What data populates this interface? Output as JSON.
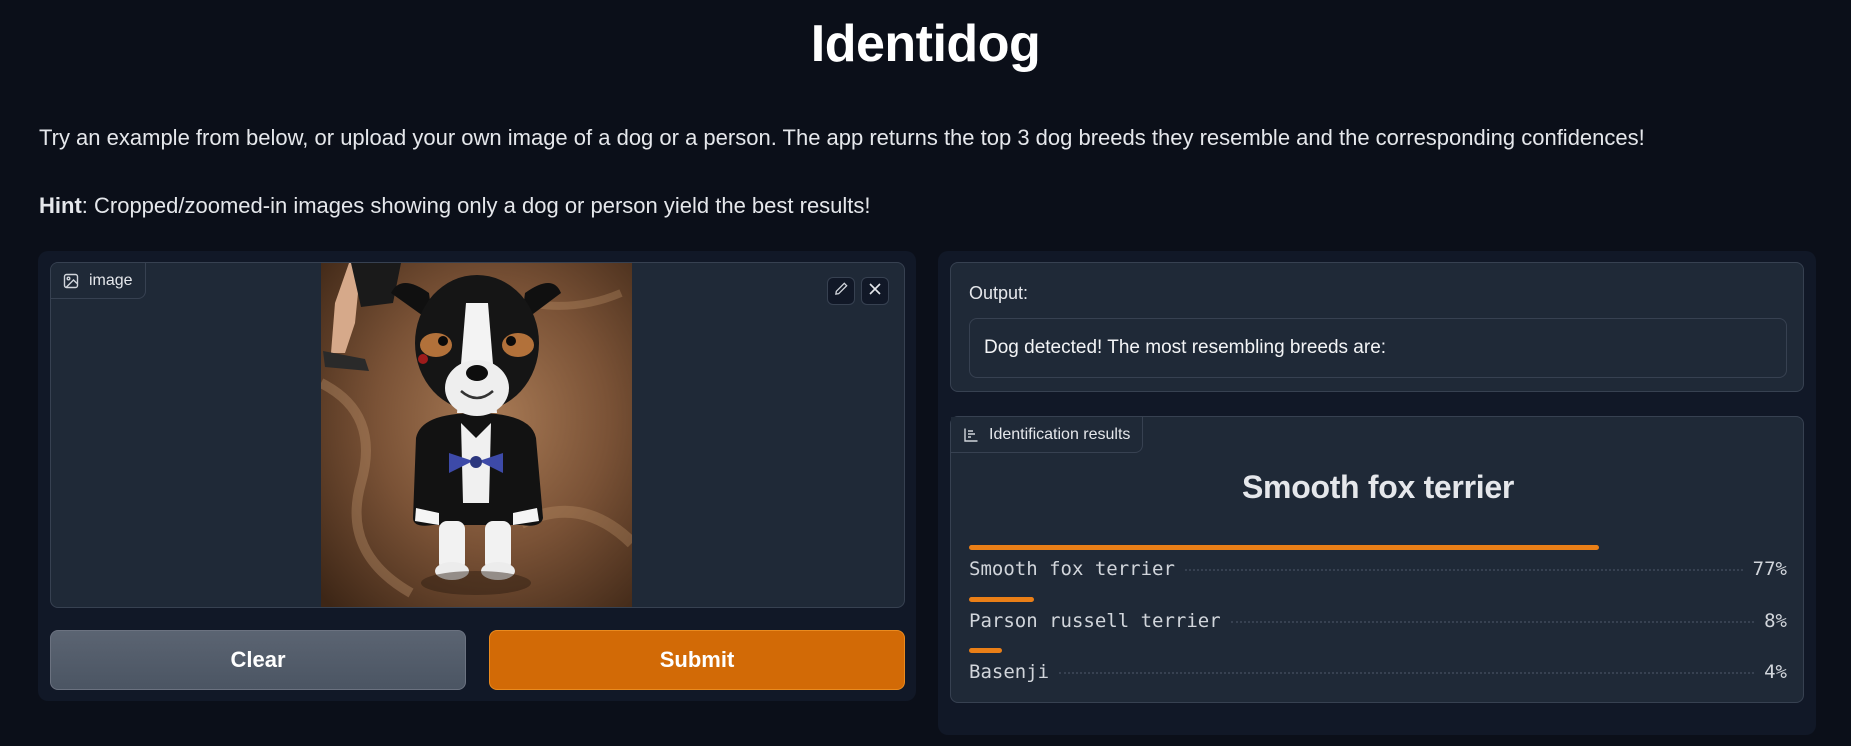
{
  "app": {
    "title": "Identidog",
    "description": "Try an example from below, or upload your own image of a dog or a person. The app returns the top 3 dog breeds they resemble and the corresponding confidences!",
    "hint_label": "Hint",
    "hint_text": ": Cropped/zoomed-in images showing only a dog or person yield the best results!"
  },
  "input": {
    "label": "image",
    "label_icon": "image-icon",
    "edit_icon": "pencil-icon",
    "close_icon": "close-icon",
    "photo_subject": "dog in tuxedo"
  },
  "buttons": {
    "clear": "Clear",
    "submit": "Submit"
  },
  "output": {
    "label": "Output:",
    "text": "Dog detected! The most resembling breeds are:"
  },
  "results": {
    "label": "Identification results",
    "label_icon": "bar-chart-icon",
    "top": "Smooth fox terrier",
    "items": [
      {
        "name": "Smooth fox terrier",
        "pct": "77%",
        "value": 0.77
      },
      {
        "name": "Parson russell terrier",
        "pct": "8%",
        "value": 0.08
      },
      {
        "name": "Basenji",
        "pct": "4%",
        "value": 0.04
      }
    ]
  },
  "colors": {
    "background": "#0b0f19",
    "panel": "#111827",
    "block": "#1f2937",
    "accent": "#d26a06",
    "bar": "#ea7f17"
  }
}
